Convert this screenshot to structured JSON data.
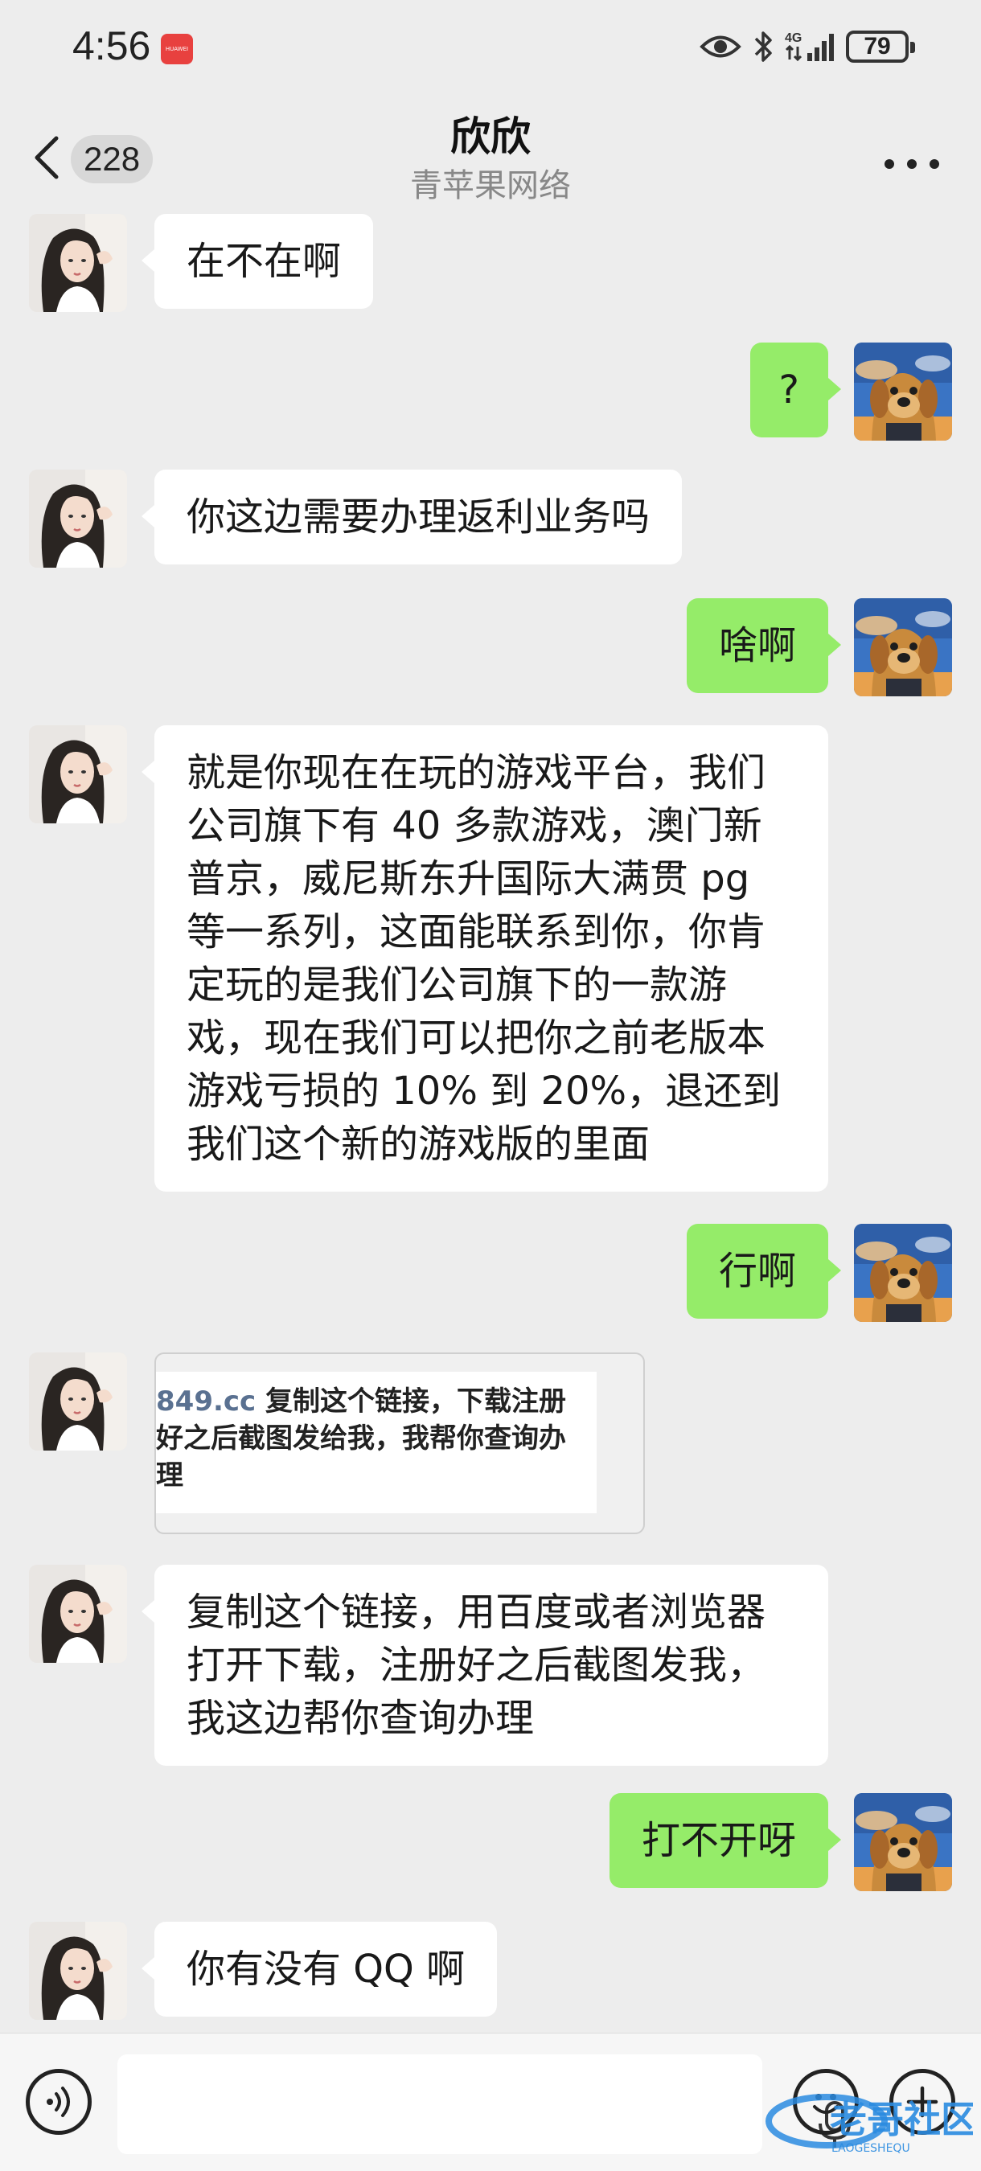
{
  "status_bar": {
    "time": "4:56",
    "app_badge": "HUAWEI",
    "network": "4G",
    "battery": "79"
  },
  "header": {
    "unread_count": "228",
    "contact_name": "欣欣",
    "contact_subtitle": "青苹果网络"
  },
  "messages": [
    {
      "side": "left",
      "text": "在不在啊"
    },
    {
      "side": "right",
      "text": "?"
    },
    {
      "side": "left",
      "text": "你这边需要办理返利业务吗"
    },
    {
      "side": "right",
      "text": "啥啊"
    },
    {
      "side": "left",
      "lines": [
        "就是你现在在玩的游戏平台，我们",
        "公司旗下有 40 多款游戏，澳门新",
        "普京，威尼斯东升国际大满贯 pg",
        "等一系列，这面能联系到你，你肯",
        "定玩的是我们公司旗下的一款游",
        "戏，现在我们可以把你之前老版本",
        "游戏亏损的 10% 到 20%，退还到",
        "我们这个新的游戏版的里面"
      ]
    },
    {
      "side": "right",
      "text": "行啊"
    },
    {
      "side": "left",
      "type": "image",
      "url_text": "849.cc",
      "lines": [
        "复制这个链接，下载注册",
        "好之后截图发给我，我帮你查询办",
        "理"
      ]
    },
    {
      "side": "left",
      "lines": [
        "复制这个链接，用百度或者浏览器",
        "打开下载，注册好之后截图发我，",
        "我这边帮你查询办理"
      ]
    },
    {
      "side": "right",
      "text": "打不开呀"
    },
    {
      "side": "left",
      "text": "你有没有 QQ 啊"
    }
  ],
  "icons": {
    "back": "chevron-left-icon",
    "more": "more-dots-icon",
    "voice": "voice-input-icon",
    "mic": "microphone-icon",
    "emoji": "emoji-icon",
    "plus": "plus-icon"
  },
  "colors": {
    "background": "#ededed",
    "sent_bubble": "#95ec69",
    "received_bubble": "#ffffff"
  },
  "watermark": {
    "brand": "老哥社区",
    "sub": "LAOGESHEQU"
  }
}
